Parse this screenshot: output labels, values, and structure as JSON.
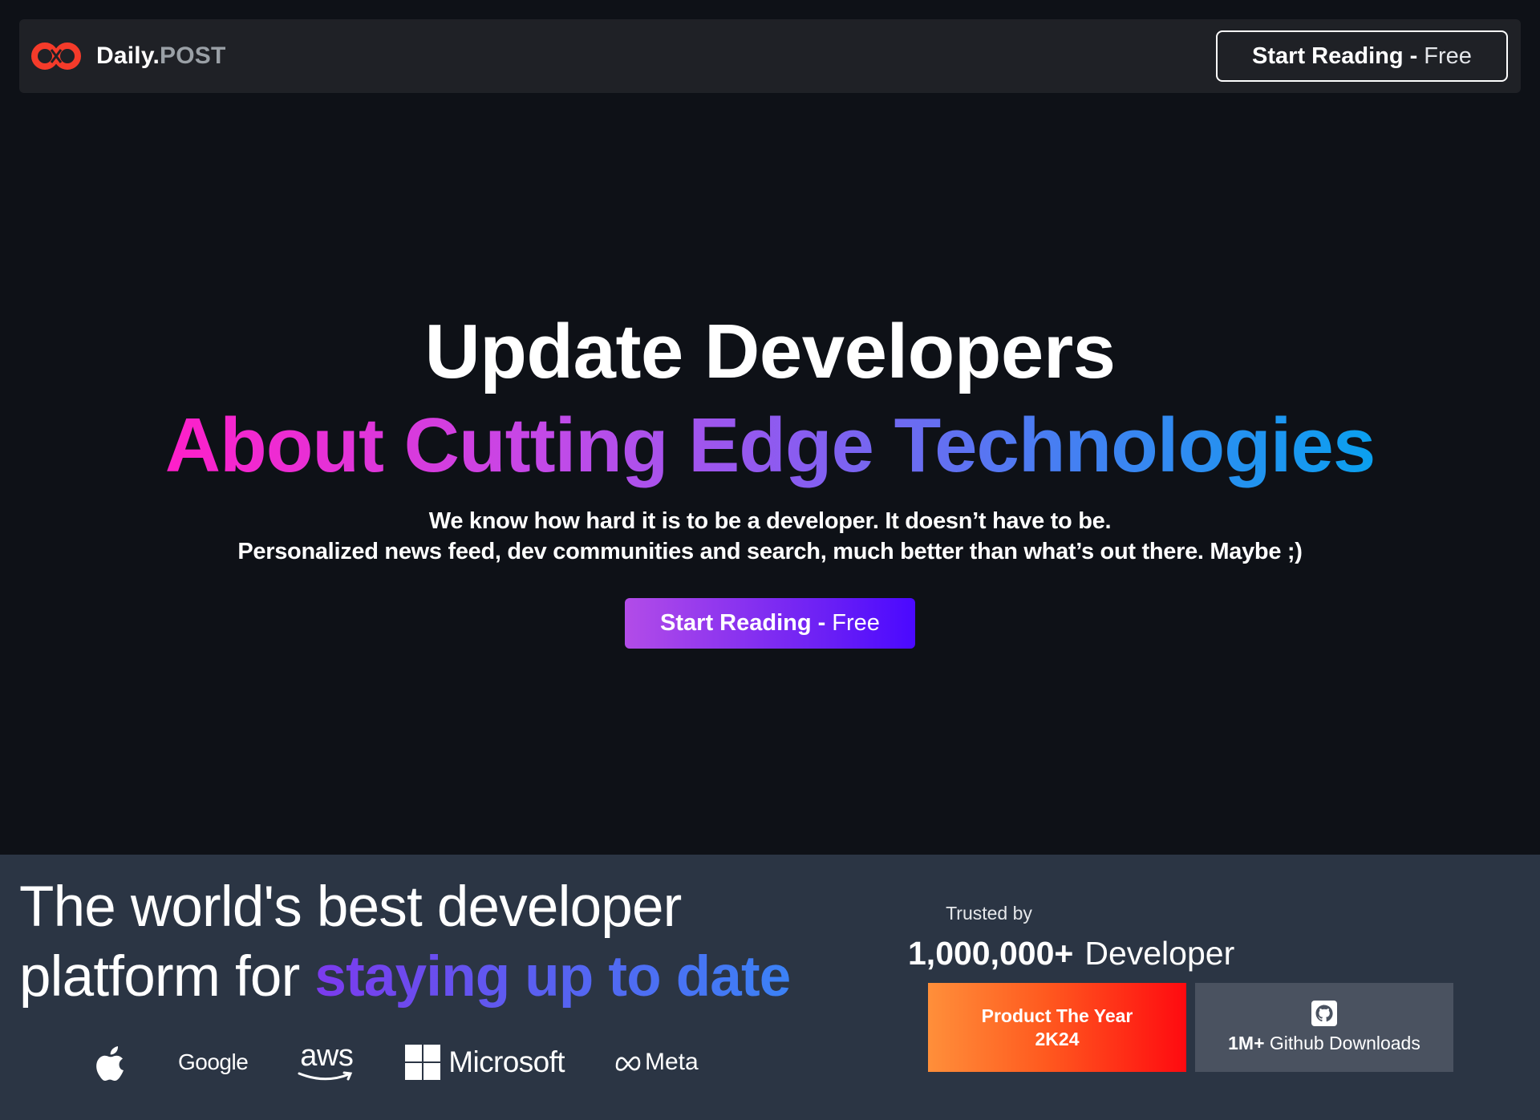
{
  "nav": {
    "brand_name": "Daily.",
    "brand_suffix": "POST",
    "cta_strong": "Start Reading -",
    "cta_light": "Free",
    "logo_icon": "infinity-logo-icon",
    "accent_color": "#f53b2a"
  },
  "hero": {
    "title": "Update Developers",
    "gradient_title": "About Cutting Edge Technologies",
    "subtitle_line1": "We know how hard it is to be a developer. It doesn’t have to be.",
    "subtitle_line2": "Personalized news feed, dev communities and search, much better than what’s out there. Maybe ;)",
    "cta_strong": "Start Reading -",
    "cta_light": "Free"
  },
  "band": {
    "tagline_line1": "The world's best developer",
    "tagline_line2_plain": "platform for ",
    "tagline_line2_accent": "staying up to date",
    "partners": [
      {
        "name": "",
        "icon": "apple-icon"
      },
      {
        "name": "Google",
        "icon": "google-icon"
      },
      {
        "name": "aws",
        "icon": "aws-icon"
      },
      {
        "name": "Microsoft",
        "icon": "microsoft-icon"
      },
      {
        "name": "Meta",
        "icon": "meta-icon"
      }
    ],
    "trusted_label": "Trusted by",
    "trusted_count": "1,000,000+",
    "trusted_unit": "Developer",
    "award_line1": "Product The Year",
    "award_line2": "2K24",
    "github_count": "1M+",
    "github_label": "Github Downloads",
    "github_icon": "github-icon"
  }
}
